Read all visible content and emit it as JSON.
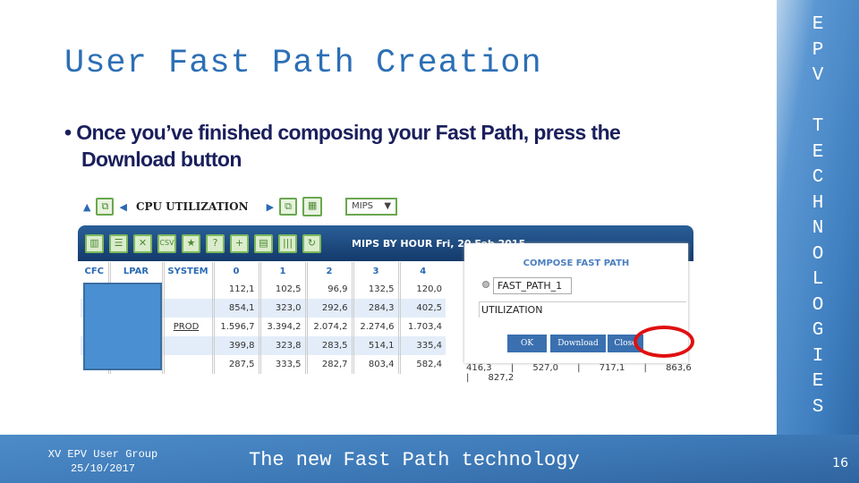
{
  "slide": {
    "title": "User Fast Path Creation",
    "bullet_line1": "• Once you’ve finished composing your Fast Path, press the",
    "bullet_line2": "Download button",
    "side_text": "E\nP\nV\n\nT\nE\nC\nH\nN\nO\nL\nO\nG\nI\nE\nS",
    "footer_org": "XV EPV User Group",
    "footer_date": "25/10/2017",
    "footer_topic": "The new Fast Path technology",
    "page_number": "16"
  },
  "app": {
    "section": "CPU UTILIZATION",
    "unit_select": "MIPS",
    "toolbar_icons": [
      "columns-icon",
      "rows-icon",
      "excel-icon",
      "csv-icon",
      "star-icon",
      "help-icon",
      "add-folder-icon",
      "compare-icon",
      "bars-icon",
      "refresh-icon"
    ],
    "csv_label": "CSV",
    "header_title": "MIPS BY HOUR Fri, 20 Feb 2015",
    "columns": [
      "CFC",
      "LPAR",
      "SYSTEM",
      "0",
      "1",
      "2",
      "3",
      "4"
    ],
    "rows": [
      {
        "system": "",
        "values": [
          "112,1",
          "102,5",
          "96,9",
          "132,5",
          "120,0"
        ]
      },
      {
        "system": "",
        "values": [
          "854,1",
          "323,0",
          "292,6",
          "284,3",
          "402,5"
        ]
      },
      {
        "system": "PROD",
        "values": [
          "1.596,7",
          "3.394,2",
          "2.074,2",
          "2.274,6",
          "1.703,4"
        ]
      },
      {
        "system": "",
        "values": [
          "399,8",
          "323,8",
          "283,5",
          "514,1",
          "335,4"
        ]
      },
      {
        "system": "",
        "values": [
          "287,5",
          "333,5",
          "282,7",
          "803,4",
          "582,4"
        ]
      }
    ],
    "last_row_extra": "416,3 | 527,0 | 717,1 | 863,6 | 827,2",
    "dialog": {
      "title": "COMPOSE FAST PATH",
      "fast_path_name": "FAST_PATH_1",
      "text_value": "UTILIZATION",
      "ok": "OK",
      "download": "Download",
      "close": "Close"
    },
    "highlight_color": "#e01010"
  }
}
